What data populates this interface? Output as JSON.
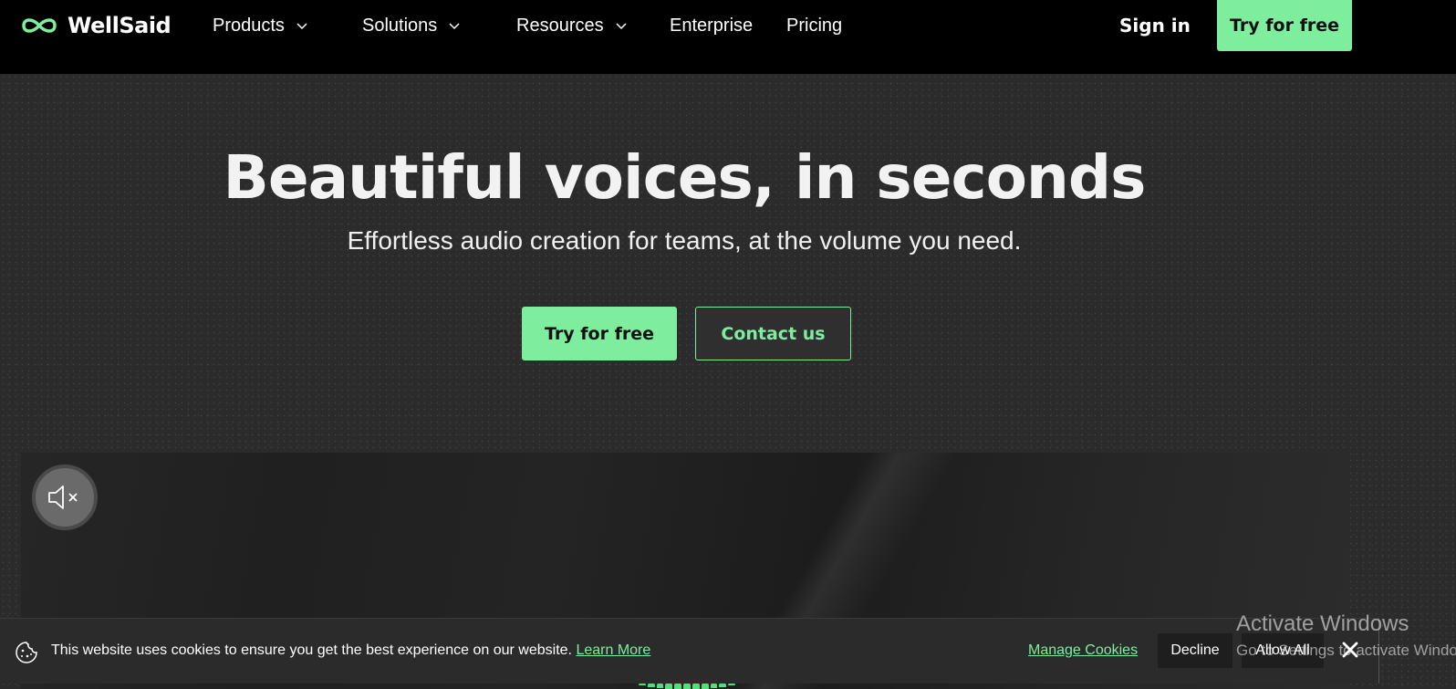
{
  "nav": {
    "logo_text": "WellSaid",
    "items": [
      {
        "label": "Products",
        "has_dropdown": true
      },
      {
        "label": "Solutions",
        "has_dropdown": true
      },
      {
        "label": "Resources",
        "has_dropdown": true
      },
      {
        "label": "Enterprise",
        "has_dropdown": false
      },
      {
        "label": "Pricing",
        "has_dropdown": false
      }
    ],
    "sign_in": "Sign in",
    "cta": "Try for free"
  },
  "hero": {
    "title": "Beautiful voices, in seconds",
    "subtitle": "Effortless audio creation for teams, at the volume you need.",
    "primary_button": "Try for free",
    "secondary_button": "Contact us"
  },
  "video": {
    "mute_icon": "speaker-muted-icon"
  },
  "cookie_banner": {
    "message": "This website uses cookies to ensure you get the best experience on our website.",
    "learn_more": "Learn More",
    "manage": "Manage Cookies",
    "decline": "Decline",
    "allow_all": "Allow All"
  },
  "os_overlay": {
    "title": "Activate Windows",
    "subtitle": "Go to Settings to activate Windows."
  },
  "colors": {
    "accent": "#7eed9d",
    "nav_bg": "#000000",
    "hero_bg": "#2b2b2b"
  }
}
